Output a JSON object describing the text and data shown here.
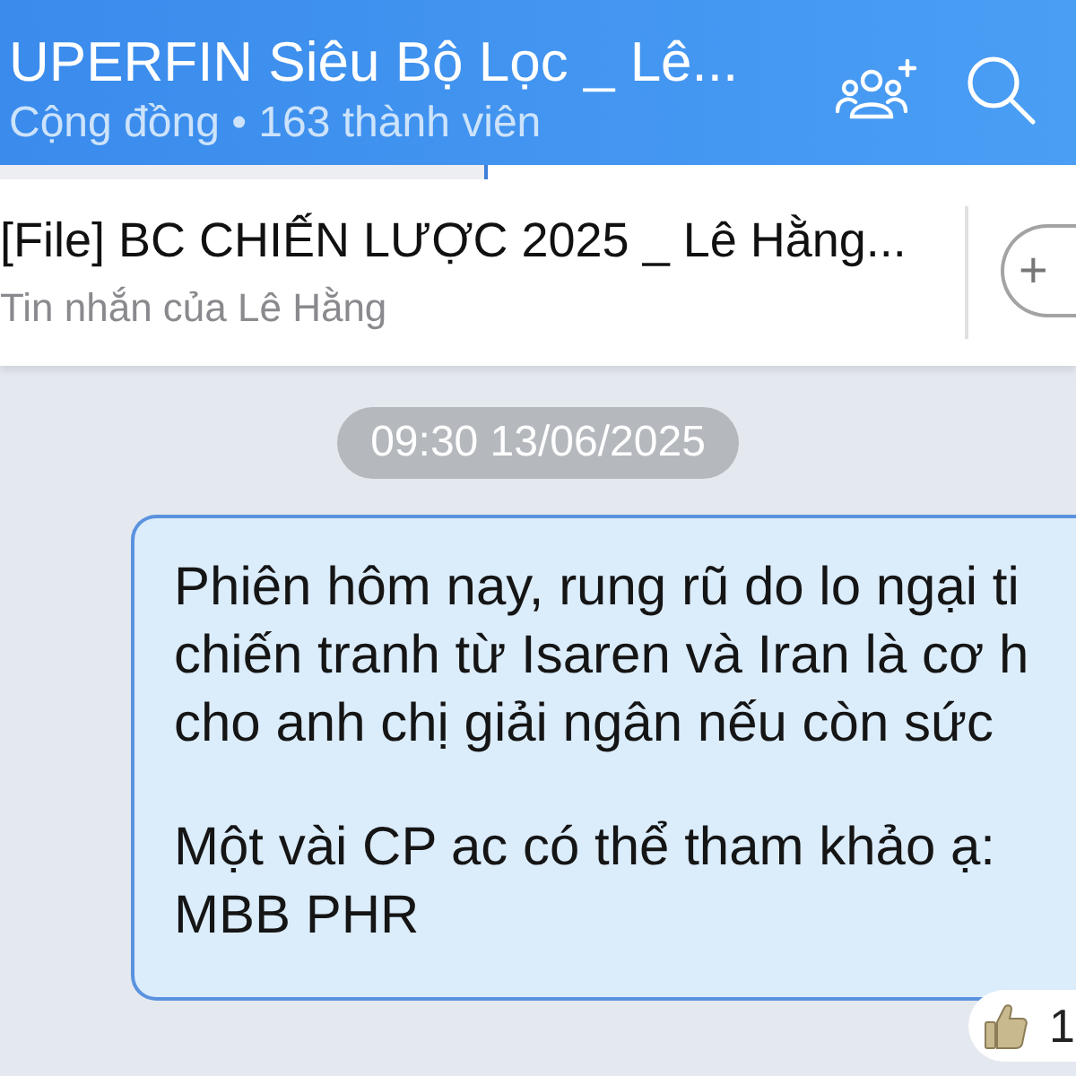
{
  "header": {
    "title": "UPERFIN Siêu Bộ Lọc _ Lê...",
    "subtitle": "Cộng đồng • 163 thành viên"
  },
  "pinned_message": {
    "title": "[File] BC CHIẾN LƯỢC 2025 _ Lê Hằng...",
    "subtitle": "Tin nhắn của Lê Hằng",
    "more_count": "+"
  },
  "chat": {
    "timestamp": "09:30 13/06/2025",
    "messages": [
      {
        "paragraphs": [
          [
            "Phiên hôm nay, rung rũ do lo ngại ti",
            "chiến tranh từ Isaren và Iran là cơ h",
            "cho anh chị giải ngân nếu còn sức"
          ],
          [
            "Một vài CP ac có thể tham khảo ạ:",
            "MBB PHR"
          ]
        ],
        "reactions": [
          {
            "count": "1"
          }
        ]
      }
    ]
  }
}
